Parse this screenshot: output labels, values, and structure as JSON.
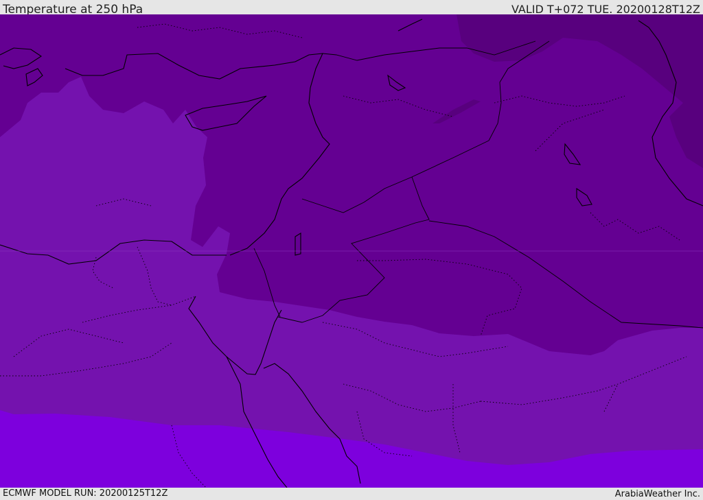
{
  "header": {
    "title": "Temperature at 250 hPa",
    "valid": "VALID T+072 TUE. 20200128T12Z"
  },
  "footer": {
    "model_run": "ECMWF MODEL RUN: 20200125T12Z",
    "credit": "ArabiaWeather Inc."
  },
  "map": {
    "fill_colors": {
      "coldest": "#58007e",
      "cold": "#640092",
      "mid": "#7412ae",
      "warm": "#7d00dd"
    },
    "line_color": "#000000",
    "border_style": "solid country borders, dotted provincial borders"
  }
}
